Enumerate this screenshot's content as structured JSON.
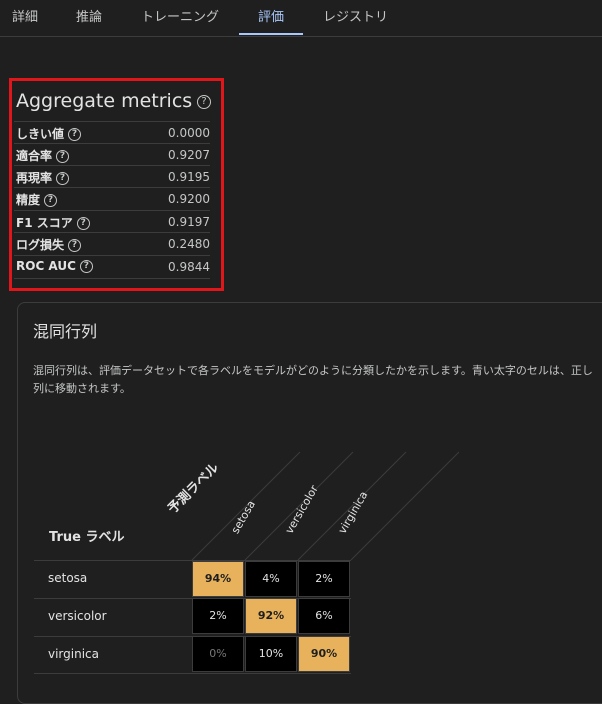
{
  "tabs": [
    "詳細",
    "推論",
    "トレーニング",
    "評価",
    "レジストリ"
  ],
  "active_tab": "評価",
  "aggregate": {
    "title": "Aggregate metrics",
    "metrics": [
      {
        "name": "しきい値",
        "value": "0.0000"
      },
      {
        "name": "適合率",
        "value": "0.9207"
      },
      {
        "name": "再現率",
        "value": "0.9195"
      },
      {
        "name": "精度",
        "value": "0.9200"
      },
      {
        "name": "F1 スコア",
        "value": "0.9197"
      },
      {
        "name": "ログ損失",
        "value": "0.2480"
      },
      {
        "name": "ROC AUC",
        "value": "0.9844"
      }
    ]
  },
  "confusion": {
    "title": "混同行列",
    "description_line1": "混同行列は、評価データセットで各ラベルをモデルがどのように分類したかを示します。青い太字のセルは、正し",
    "description_line2": "列に移動されます。",
    "predicted_label": "予測ラベル",
    "true_label": "True ラベル",
    "columns": [
      "setosa",
      "versicolor",
      "virginica"
    ],
    "rows": [
      {
        "label": "setosa",
        "cells": [
          "94%",
          "4%",
          "2%"
        ]
      },
      {
        "label": "versicolor",
        "cells": [
          "2%",
          "92%",
          "6%"
        ]
      },
      {
        "label": "virginica",
        "cells": [
          "0%",
          "10%",
          "90%"
        ]
      }
    ]
  },
  "colors": {
    "highlight": "#e8b25c",
    "accent": "#a8c7fa",
    "annotation": "#e0161b"
  }
}
